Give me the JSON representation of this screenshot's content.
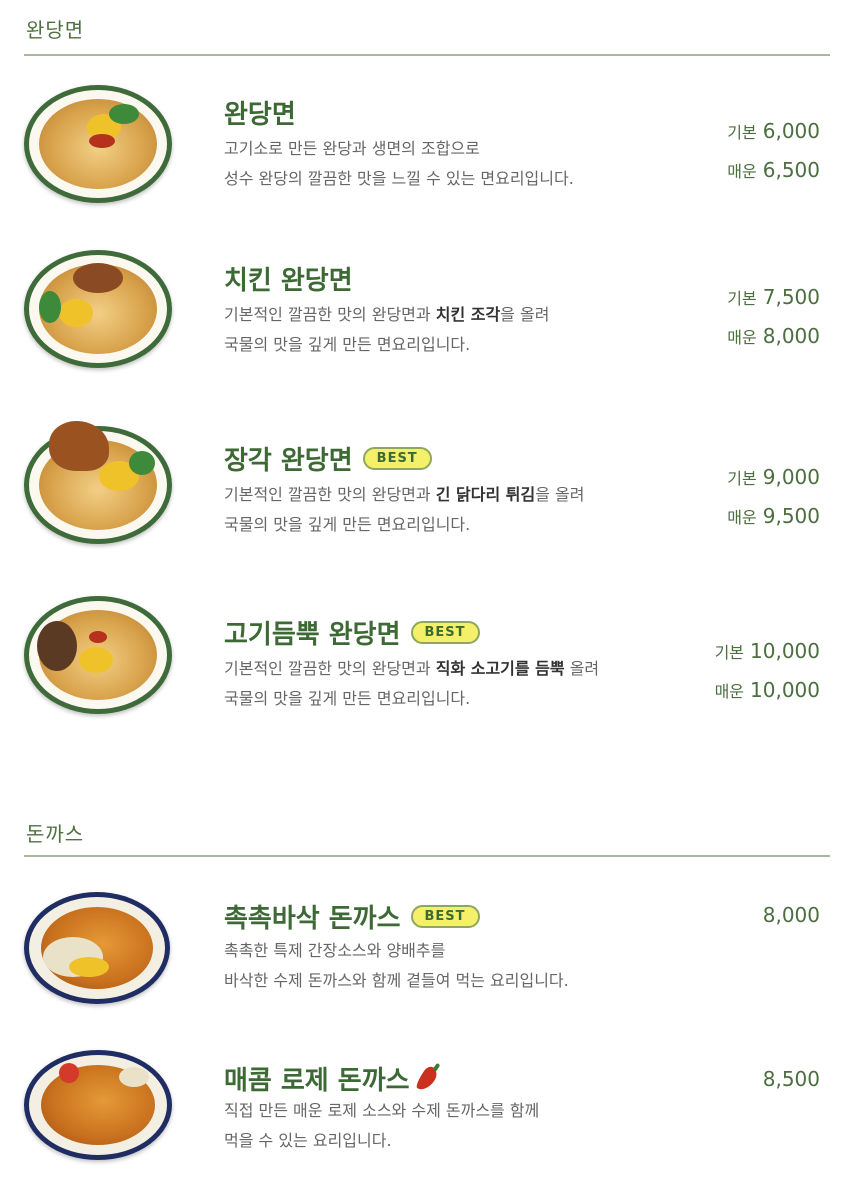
{
  "sections": [
    {
      "title": "완당면",
      "items": [
        {
          "name": "완당면",
          "badge": "",
          "desc1": "고기소로 만든 완당과 생면의 조합으로",
          "desc2": "성수 완당의 깔끔한 맛을 느낄 수 있는 면요리입니다.",
          "prices": [
            {
              "label": "기본",
              "value": "6,000"
            },
            {
              "label": "매운",
              "value": "6,500"
            }
          ]
        },
        {
          "name": "치킨 완당면",
          "badge": "",
          "desc1_pre": "기본적인 깔끔한 맛의 완당면과 ",
          "desc1_bold": "치킨 조각",
          "desc1_post": "을 올려",
          "desc2": "국물의 맛을 깊게 만든 면요리입니다.",
          "prices": [
            {
              "label": "기본",
              "value": "7,500"
            },
            {
              "label": "매운",
              "value": "8,000"
            }
          ]
        },
        {
          "name": "장각 완당면",
          "badge": "BEST",
          "desc1_pre": "기본적인 깔끔한 맛의 완당면과 ",
          "desc1_bold": "긴 닭다리 튀김",
          "desc1_post": "을 올려",
          "desc2": "국물의 맛을 깊게 만든 면요리입니다.",
          "prices": [
            {
              "label": "기본",
              "value": "9,000"
            },
            {
              "label": "매운",
              "value": "9,500"
            }
          ]
        },
        {
          "name": "고기듬뿍 완당면",
          "badge": "BEST",
          "desc1_pre": "기본적인 깔끔한 맛의 완당면과 ",
          "desc1_bold": "직화 소고기를 듬뿍",
          "desc1_post": " 올려",
          "desc2": "국물의 맛을 깊게 만든 면요리입니다.",
          "prices": [
            {
              "label": "기본",
              "value": "10,000"
            },
            {
              "label": "매운",
              "value": "10,000"
            }
          ]
        }
      ]
    },
    {
      "title": "돈까스",
      "items": [
        {
          "name": "촉촉바삭 돈까스",
          "badge": "BEST",
          "desc1": "촉촉한 특제 간장소스와 양배추를",
          "desc2": "바삭한 수제 돈까스와 함께 곁들여 먹는 요리입니다.",
          "price": "8,000"
        },
        {
          "name": "매콤 로제 돈까스",
          "icon": "chili-pepper-icon",
          "desc1": "직접 만든 매운 로제 소스와 수제 돈까스를 함께",
          "desc2": "먹을 수 있는 요리입니다.",
          "price": "8,500"
        }
      ]
    }
  ],
  "colors": {
    "accent": "#3d6a34",
    "badge": "#f4f06a",
    "rule": "#a9b89a"
  }
}
